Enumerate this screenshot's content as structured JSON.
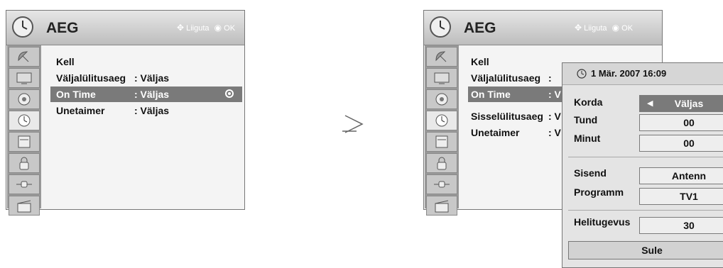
{
  "left_menu": {
    "title": "AEG",
    "hint_move": "Liiguta",
    "hint_ok": "OK",
    "rows": [
      {
        "label": "Kell",
        "value": ""
      },
      {
        "label": "Väljalülitusaeg",
        "value": ": Väljas"
      },
      {
        "label": "On Time",
        "value": ": Väljas"
      },
      {
        "label": "Unetaimer",
        "value": ": Väljas"
      }
    ]
  },
  "right_menu": {
    "title": "AEG",
    "hint_move": "Liiguta",
    "hint_ok": "OK",
    "rows": [
      {
        "label": "Kell",
        "value": ""
      },
      {
        "label": "Väljalülitusaeg",
        "value": ":"
      },
      {
        "label": "On Time",
        "value": ": V"
      },
      {
        "label": "Sisselülitusaeg",
        "value": ": V"
      },
      {
        "label": "Unetaimer",
        "value": ": V"
      }
    ]
  },
  "popup": {
    "datetime": "1 Mär. 2007 16:09",
    "fields": [
      {
        "label": "Korda",
        "value": "Väljas"
      },
      {
        "label": "Tund",
        "value": "00"
      },
      {
        "label": "Minut",
        "value": "00"
      },
      {
        "label": "Sisend",
        "value": "Antenn"
      },
      {
        "label": "Programm",
        "value": "TV1"
      },
      {
        "label": "Helitugevus",
        "value": "30"
      }
    ],
    "close_label": "Sule"
  },
  "icons": [
    "clock-icon",
    "satellite-dish-icon",
    "tv-screen-icon",
    "disc-icon",
    "timer-icon",
    "calendar-icon",
    "lock-icon",
    "plug-icon",
    "clapperboard-icon",
    "direction-pad-icon",
    "ok-circle-icon",
    "arrow-right-icon"
  ],
  "colors": {
    "header": "#bdbdbd",
    "selected_row": "#7a7a7a",
    "sidebar": "#999999",
    "popup_bg": "#e4e4e4"
  }
}
